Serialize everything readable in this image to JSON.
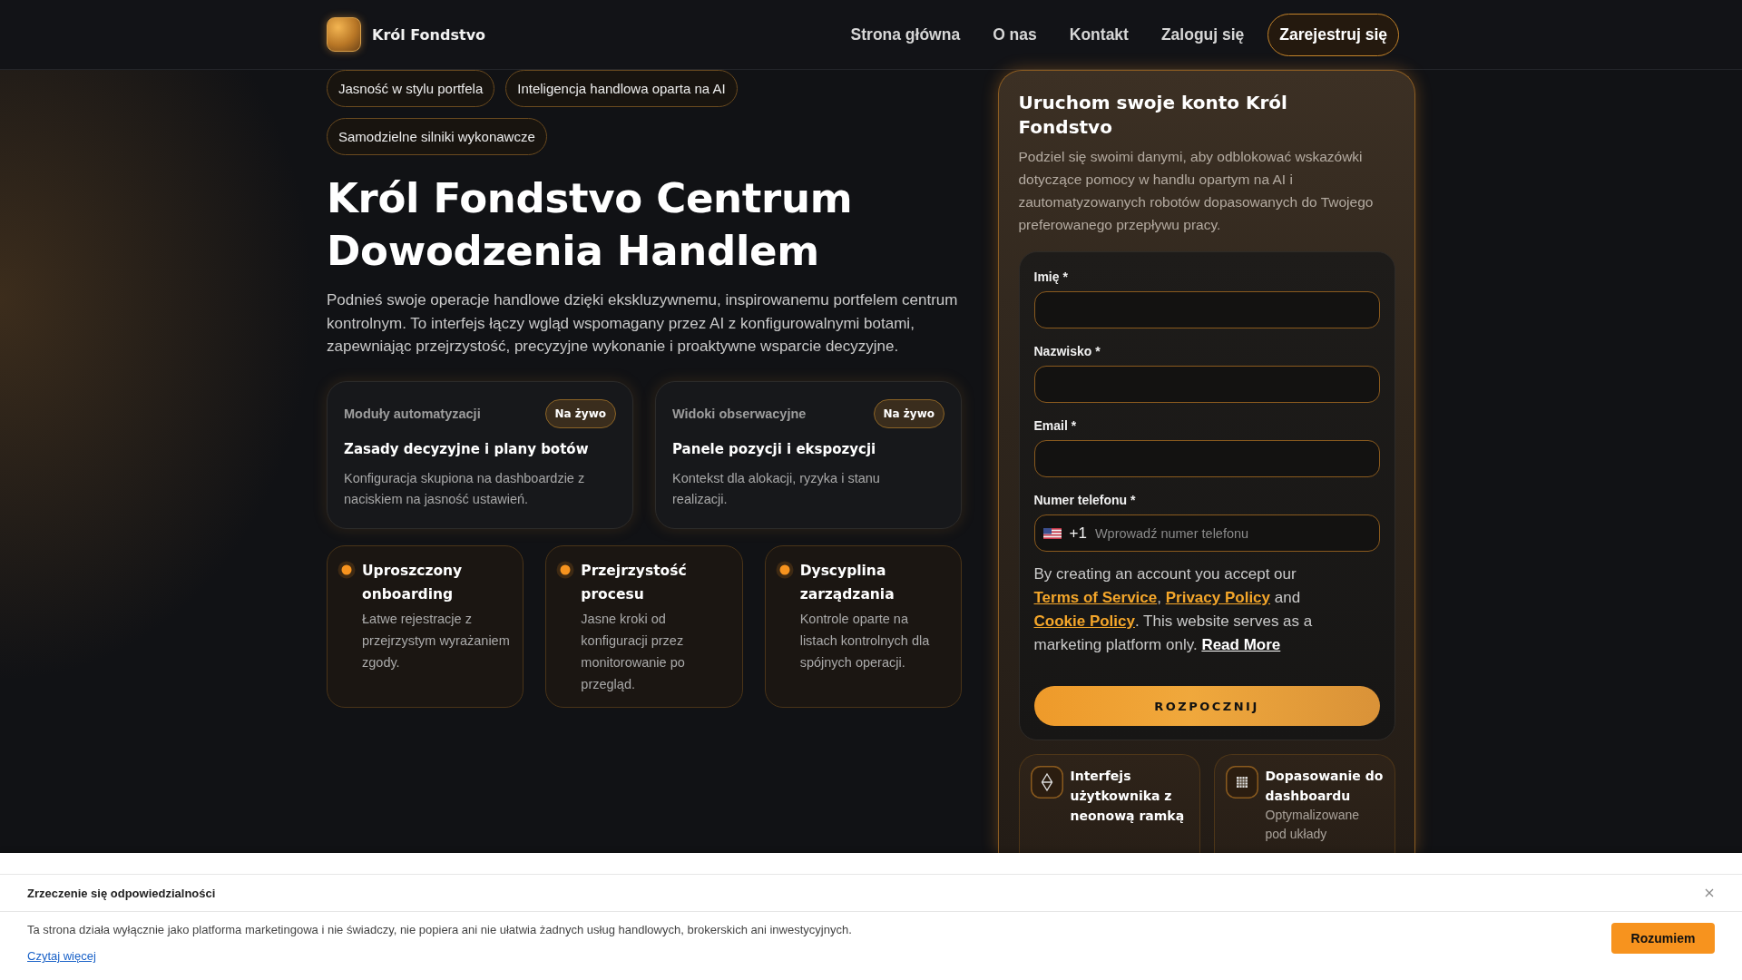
{
  "header": {
    "brand": "Król Fondstvo",
    "nav": [
      "Strona główna",
      "O nas",
      "Kontakt",
      "Zaloguj się"
    ],
    "register_button": "Zarejestruj się"
  },
  "hero": {
    "chips": [
      "Jasność w stylu portfela",
      "Inteligencja handlowa oparta na AI",
      "Samodzielne silniki wykonawcze"
    ],
    "title": "Król Fondstvo Centrum Dowodzenia Handlem",
    "description": "Podnieś swoje operacje handlowe dzięki ekskluzywnemu, inspirowanemu portfelem centrum kontrolnym. To interfejs łączy wgląd wspomagany przez AI z konfigurowalnymi botami, zapewniając przejrzystość, precyzyjne wykonanie i proaktywne wsparcie decyzyjne.",
    "cards": [
      {
        "label": "Moduły automatyzacji",
        "badge": "Na żywo",
        "title": "Zasady decyzyjne i plany botów",
        "description": "Konfiguracja skupiona na dashboardzie z naciskiem na jasność ustawień."
      },
      {
        "label": "Widoki obserwacyjne",
        "badge": "Na żywo",
        "title": "Panele pozycji i ekspozycji",
        "description": "Kontekst dla alokacji, ryzyka i stanu realizacji."
      }
    ],
    "features": [
      {
        "title": "Uproszczony onboarding",
        "description": "Łatwe rejestracje z przejrzystym wyrażaniem zgody."
      },
      {
        "title": "Przejrzystość procesu",
        "description": "Jasne kroki od konfiguracji przez monitorowanie po przegląd."
      },
      {
        "title": "Dyscyplina zarządzania",
        "description": "Kontrole oparte na listach kontrolnych dla spójnych operacji."
      }
    ]
  },
  "signup": {
    "title": "Uruchom swoje konto Król Fondstvo",
    "description": "Podziel się swoimi danymi, aby odblokować wskazówki dotyczące pomocy w handlu opartym na AI i zautomatyzowanych robotów dopasowanych do Twojego preferowanego przepływu pracy.",
    "fields": [
      {
        "kind": "text",
        "label": "Imię *"
      },
      {
        "kind": "text",
        "label": "Nazwisko *"
      },
      {
        "kind": "text",
        "label": "Email *"
      },
      {
        "kind": "phone",
        "label": "Numer telefonu *",
        "country_code": "+1",
        "placeholder": "Wprowadź numer telefonu"
      }
    ],
    "terms": [
      {
        "kind": "text",
        "text": "By creating an account you accept our "
      },
      {
        "kind": "link",
        "accent": true,
        "text": "Terms of Service"
      },
      {
        "kind": "text",
        "text": ", "
      },
      {
        "kind": "link",
        "accent": true,
        "text": "Privacy Policy"
      },
      {
        "kind": "text",
        "text": " and "
      },
      {
        "kind": "link",
        "accent": true,
        "text": "Cookie Policy"
      },
      {
        "kind": "text",
        "text": ". This website serves as a marketing platform only. "
      },
      {
        "kind": "link",
        "accent": false,
        "text": "Read More"
      }
    ],
    "submit_button": "ROZPOCZNIJ",
    "highlights": [
      {
        "title": "Interfejs użytkownika z neonową ramką"
      },
      {
        "title": "Dopasowanie do dashboardu",
        "description": "Optymalizowane pod układy"
      }
    ]
  },
  "disclaimer": {
    "title": "Zrzeczenie się odpowiedzialności",
    "text": "Ta strona działa wyłącznie jako platforma marketingowa i nie świadczy, nie popiera ani nie ułatwia żadnych usług handlowych, brokerskich ani inwestycyjnych.",
    "link": "Czytaj więcej",
    "button": "Rozumiem"
  }
}
